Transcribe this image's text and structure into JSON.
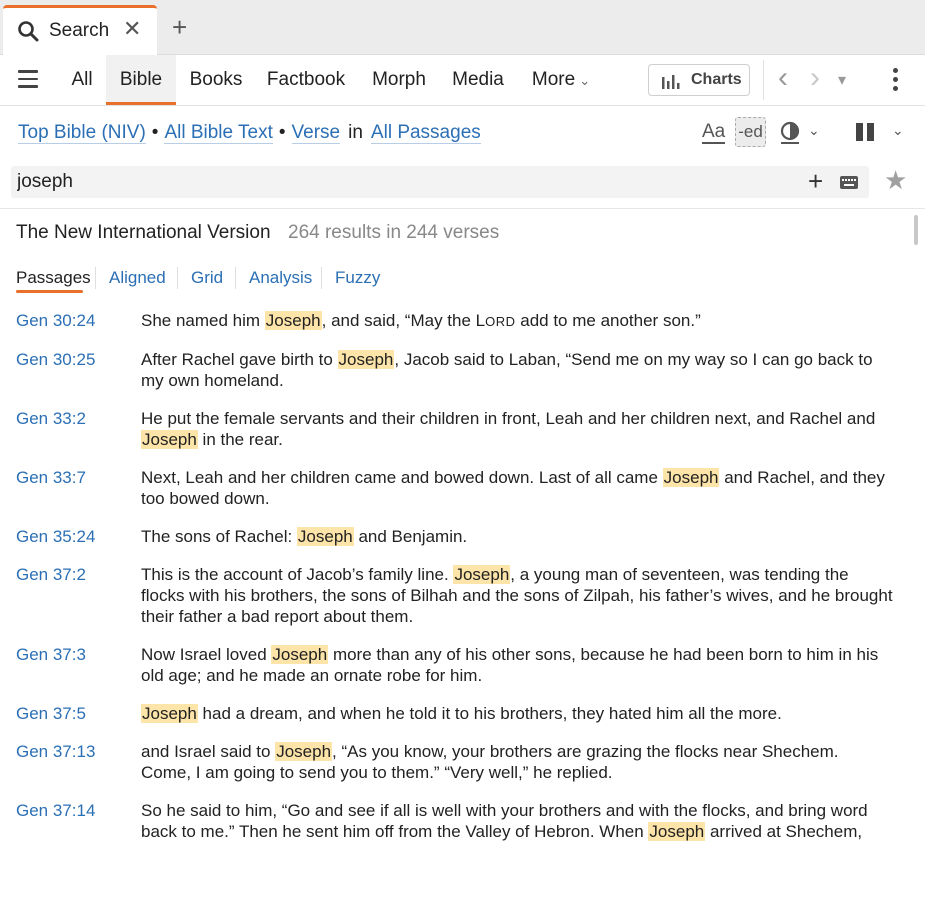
{
  "tab": {
    "title": "Search",
    "close": "✕",
    "add": "+"
  },
  "nav": {
    "tabs": [
      "All",
      "Bible",
      "Books",
      "Factbook",
      "Morph",
      "Media",
      "More"
    ],
    "more_chevron": "⌄",
    "charts_label": "Charts",
    "back": "‹",
    "forward": "›",
    "history": "▾"
  },
  "crumbs": {
    "resource": "Top Bible (NIV)",
    "bullet": "•",
    "scope": "All Bible Text",
    "unit": "Verse",
    "in": "in",
    "range": "All Passages"
  },
  "tools": {
    "font": "Aa",
    "inflected": "-ed",
    "chevron": "⌄"
  },
  "search": {
    "query": "joseph",
    "add": "+",
    "star": "★"
  },
  "results_header": {
    "title": "The New International Version",
    "count": "264 results in 244 verses"
  },
  "result_tabs": [
    "Passages",
    "Aligned",
    "Grid",
    "Analysis",
    "Fuzzy"
  ],
  "hit_word": "Joseph",
  "results": [
    {
      "ref": "Gen 30:24",
      "parts": [
        "She named him ",
        "Joseph",
        ", and said, “May the ",
        "Lord",
        " add to me another son.”"
      ]
    },
    {
      "ref": "Gen 30:25",
      "parts": [
        "After Rachel gave birth to ",
        "Joseph",
        ", Jacob said to Laban, “Send me on my way so I can go back to my own homeland."
      ]
    },
    {
      "ref": "Gen 33:2",
      "parts": [
        "He put the female servants and their children in front, Leah and her children next, and Rachel and ",
        "Joseph",
        " in the rear."
      ]
    },
    {
      "ref": "Gen 33:7",
      "parts": [
        "Next, Leah and her children came and bowed down. Last of all came ",
        "Joseph",
        " and Rachel, and they too bowed down."
      ]
    },
    {
      "ref": "Gen 35:24",
      "parts": [
        "The sons of Rachel: ",
        "Joseph",
        " and Benjamin."
      ]
    },
    {
      "ref": "Gen 37:2",
      "parts": [
        "This is the account of Jacob’s family line. ",
        "Joseph",
        ", a young man of seventeen, was tending the flocks with his brothers, the sons of Bilhah and the sons of Zilpah, his father’s wives, and he brought their father a bad report about them."
      ]
    },
    {
      "ref": "Gen 37:3",
      "parts": [
        "Now Israel loved ",
        "Joseph",
        " more than any of his other sons, because he had been born to him in his old age; and he made an ornate robe for him."
      ]
    },
    {
      "ref": "Gen 37:5",
      "parts": [
        "",
        "Joseph",
        " had a dream, and when he told it to his brothers, they hated him all the more."
      ]
    },
    {
      "ref": "Gen 37:13",
      "parts": [
        "and Israel said to ",
        "Joseph",
        ", “As you know, your brothers are grazing the flocks near Shechem. Come, I am going to send you to them.” “Very well,” he replied."
      ]
    },
    {
      "ref": "Gen 37:14",
      "parts": [
        "So he said to him, “Go and see if all is well with your brothers and with the flocks, and bring word back to me.” Then he sent him off from the Valley of Hebron. When ",
        "Joseph",
        " arrived at Shechem,"
      ]
    }
  ]
}
